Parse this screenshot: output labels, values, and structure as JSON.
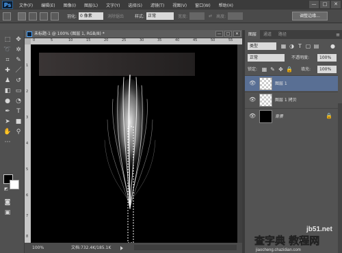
{
  "app": {
    "logo": "Ps"
  },
  "menubar": {
    "items": [
      "文件(F)",
      "编辑(E)",
      "图像(I)",
      "图层(L)",
      "文字(Y)",
      "选择(S)",
      "滤镜(T)",
      "视图(V)",
      "窗口(W)",
      "帮助(H)"
    ],
    "controls": [
      "—",
      "□",
      "✕"
    ]
  },
  "options_bar": {
    "feather_label": "羽化:",
    "feather_value": "0 像素",
    "antialias_label": "消除锯齿",
    "style_label": "样式:",
    "style_value": "正常",
    "width_label": "宽度:",
    "height_label": "高度:",
    "refine_edge_button": "调整边缘..."
  },
  "document": {
    "title": "未标题-1 @ 100% (图层 1, RGB/8) *",
    "controls": [
      "—",
      "□",
      "✕"
    ],
    "ruler_top": [
      "0",
      "5",
      "10",
      "15",
      "20",
      "25",
      "30",
      "35",
      "40",
      "45",
      "50",
      "55"
    ],
    "ruler_left": [
      "1",
      "2",
      "3",
      "4",
      "5",
      "6",
      "7",
      "8"
    ]
  },
  "statusbar": {
    "zoom": "100%",
    "doc_info": "文档:732.4K/185.1K"
  },
  "layers_panel": {
    "tabs": [
      "图层",
      "通道",
      "路径"
    ],
    "kind_filter": "类型",
    "blend_mode": "正常",
    "opacity_label": "不透明度:",
    "opacity_value": "100%",
    "lock_label": "锁定:",
    "fill_label": "填充:",
    "fill_value": "100%",
    "layers": [
      {
        "name": "图层 1",
        "selected": true,
        "locked": false
      },
      {
        "name": "图层 1 拷贝",
        "selected": false,
        "locked": false
      },
      {
        "name": "背景",
        "selected": false,
        "locked": true
      }
    ]
  },
  "watermark": {
    "line1": "jb51.net",
    "line2": "查字典 教程网",
    "line3": "jiaocheng.chazidian.com"
  },
  "colors": {
    "ui_dark": "#535353",
    "selection_blue": "#596f94",
    "canvas": "#000000",
    "foreground": "#000000",
    "background": "#ffffff"
  }
}
